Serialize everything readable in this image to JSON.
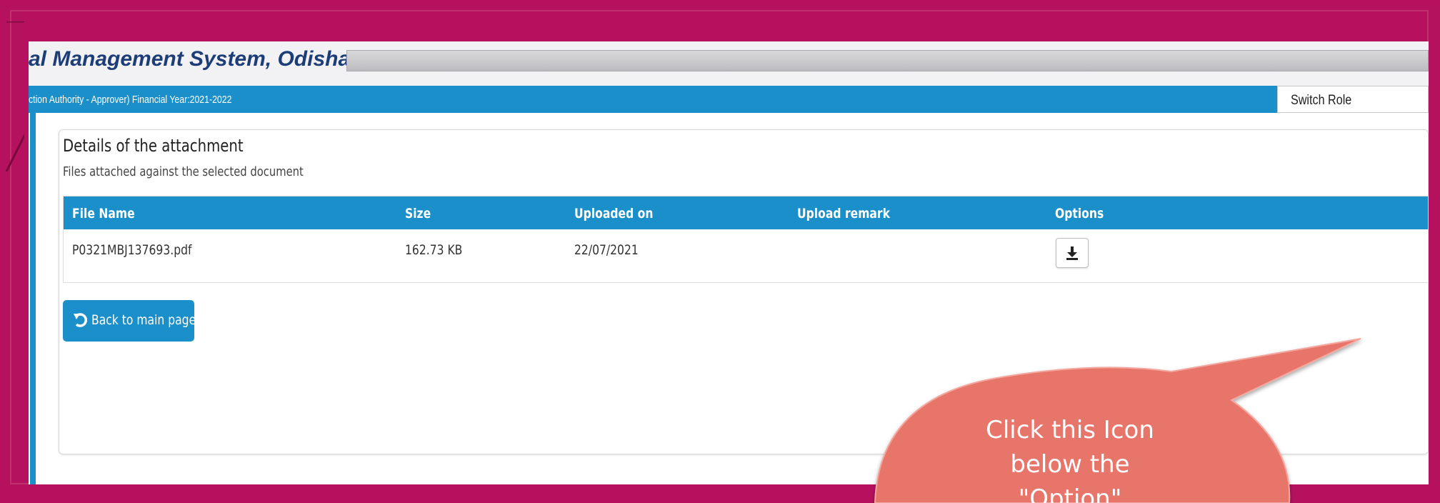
{
  "app": {
    "title": "al Management System, Odisha",
    "role_info": "ction Authority - Approver)  Financial Year:2021-2022",
    "switch_role_label": "Switch Role"
  },
  "attachment_panel": {
    "title": "Details of the attachment",
    "subtitle": "Files attached against the selected document",
    "columns": [
      "File Name",
      "Size",
      "Uploaded on",
      "Upload remark",
      "Options"
    ],
    "rows": [
      {
        "file_name": "P0321MBJ137693.pdf",
        "size": "162.73 KB",
        "uploaded_on": "22/07/2021",
        "upload_remark": "",
        "option_icon": "download-icon"
      }
    ],
    "back_button_label": "Back to main page",
    "back_icon": "undo-icon"
  },
  "callout": {
    "lines": [
      "Click this Icon",
      "below the",
      "\"Option\""
    ],
    "color": "#e8756a"
  },
  "colors": {
    "frame": "#b5115f",
    "primary": "#1a8fc9",
    "title_text": "#1d3d78"
  }
}
